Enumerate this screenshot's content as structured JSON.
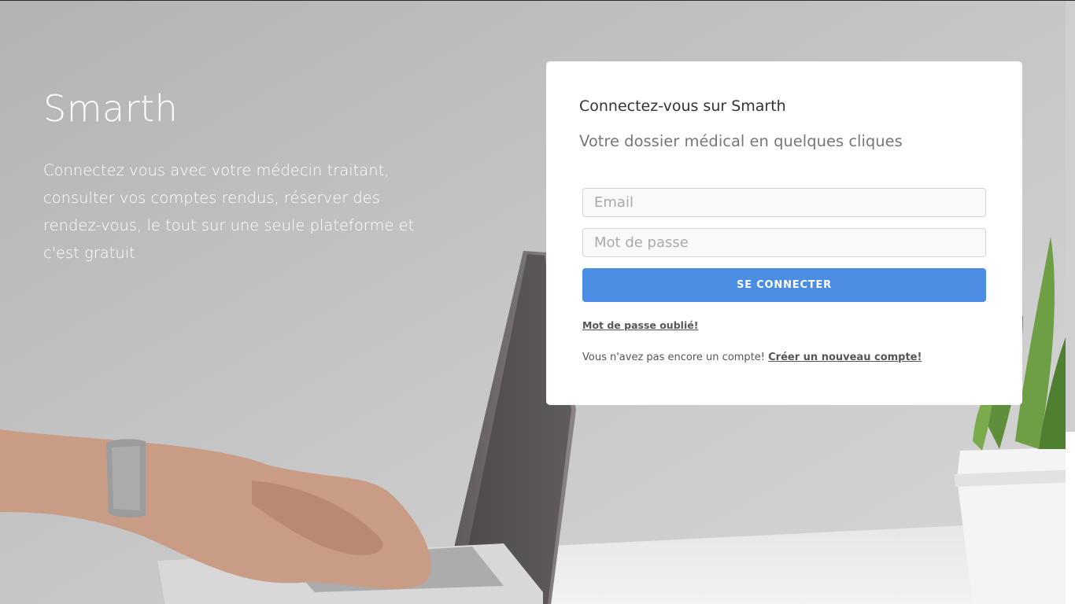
{
  "colors": {
    "primary": "#4a8de3",
    "card_background": "#ffffff",
    "hero_text": "#ffffff"
  },
  "hero": {
    "brand": "Smarth",
    "description": "Connectez vous avec votre médecin traitant, consulter vos comptes rendus, réserver des rendez-vous, le tout sur une seule plateforme et c'est gratuit"
  },
  "login": {
    "title": "Connectez-vous sur Smarth",
    "subtitle": "Votre dossier médical en quelques cliques",
    "email_placeholder": "Email",
    "password_placeholder": "Mot de passe",
    "submit_label": "SE CONNECTER",
    "forgot_password": "Mot de passe oublié!",
    "no_account_text": "Vous n'avez pas encore un compte!",
    "create_account": "Créer un nouveau compte!"
  }
}
